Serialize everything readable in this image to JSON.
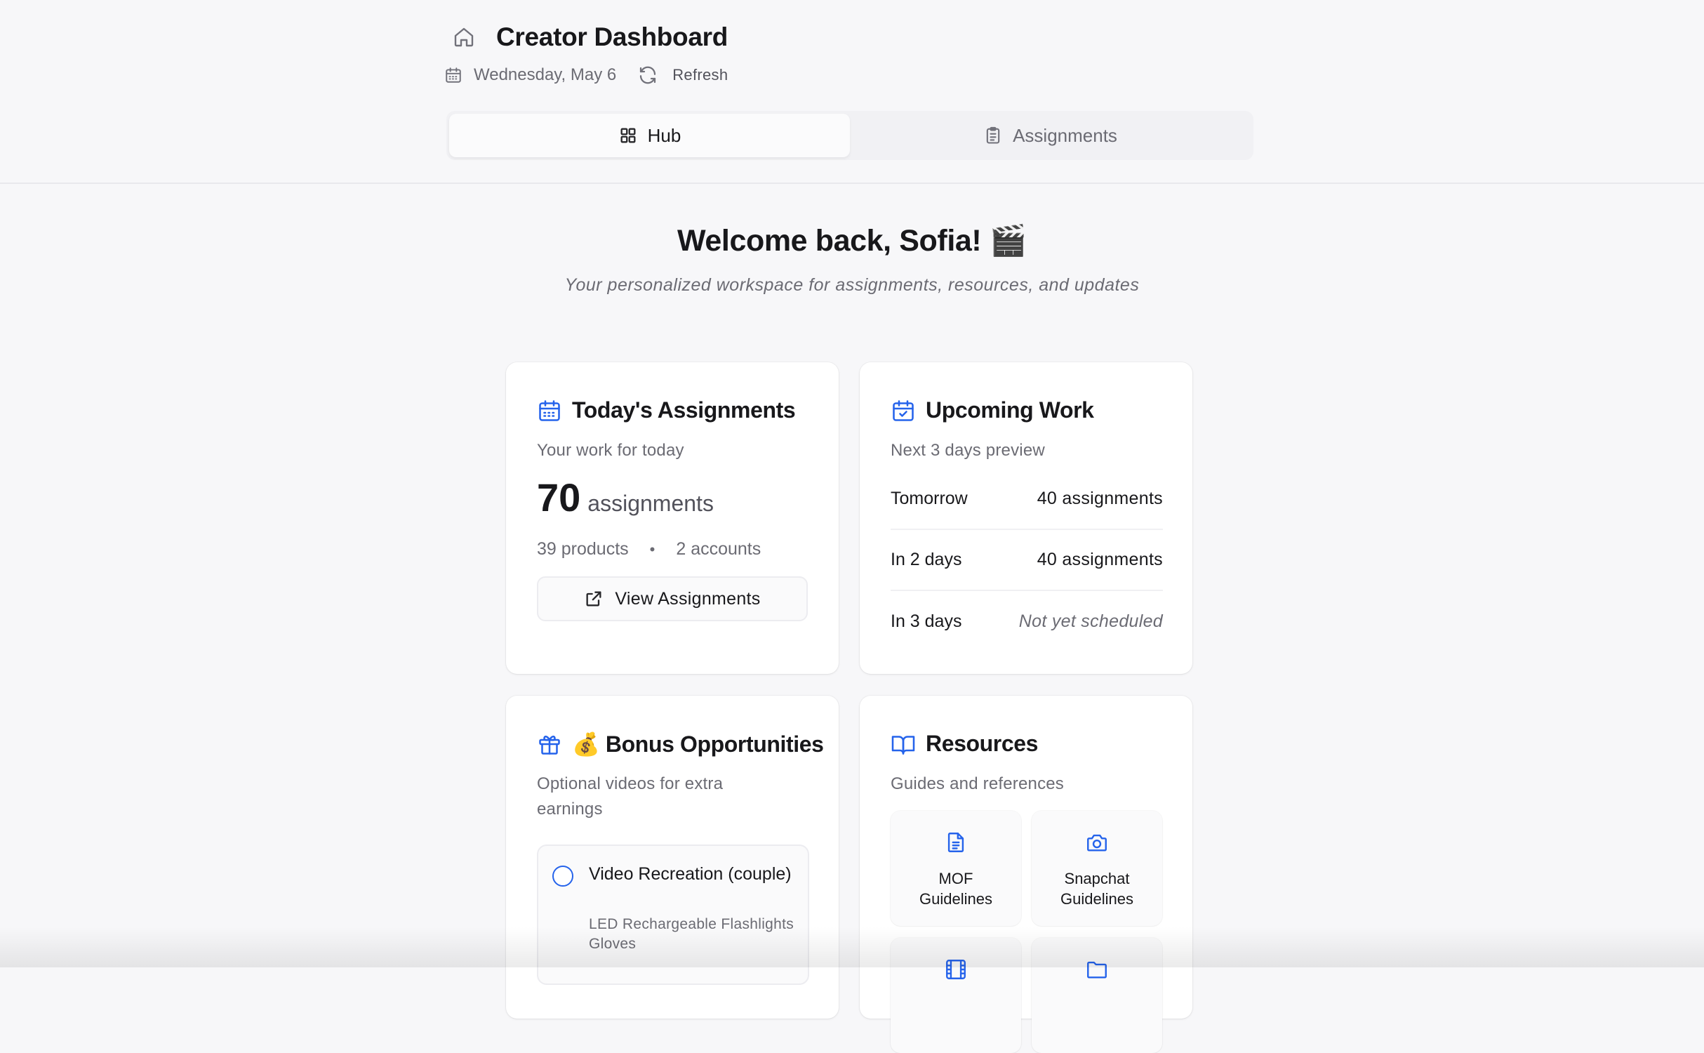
{
  "header": {
    "title": "Creator Dashboard",
    "date": "Wednesday, May 6",
    "refresh_label": "Refresh",
    "icons": {
      "home": "home-icon",
      "calendar": "calendar-icon",
      "refresh": "refresh-icon"
    }
  },
  "tabs": [
    {
      "label": "Hub",
      "icon": "grid-icon",
      "active": true
    },
    {
      "label": "Assignments",
      "icon": "clipboard-icon",
      "active": false
    }
  ],
  "welcome": {
    "title": "Welcome back, Sofia! 🎬",
    "subtitle": "Your personalized workspace for assignments, resources, and updates"
  },
  "today": {
    "title": "Today's Assignments",
    "subtitle": "Your work for today",
    "count": "70",
    "count_unit": "assignments",
    "products": "39 products",
    "separator": "•",
    "accounts": "2 accounts",
    "button_label": "View Assignments"
  },
  "upcoming": {
    "title": "Upcoming Work",
    "subtitle": "Next 3 days preview",
    "rows": [
      {
        "label": "Tomorrow",
        "value": "40 assignments",
        "scheduled": true
      },
      {
        "label": "In 2 days",
        "value": "40 assignments",
        "scheduled": true
      },
      {
        "label": "In 3 days",
        "value": "Not yet scheduled",
        "scheduled": false
      }
    ]
  },
  "bonus": {
    "title": "💰 Bonus Opportunities",
    "subtitle": "Optional videos for extra earnings",
    "items": [
      {
        "title": "Video Recreation (couple)",
        "product": "LED Rechargeable Flashlights Gloves"
      }
    ]
  },
  "resources": {
    "title": "Resources",
    "subtitle": "Guides and references",
    "tiles": [
      {
        "label": "MOF Guidelines",
        "icon": "document-icon"
      },
      {
        "label": "Snapchat Guidelines",
        "icon": "camera-icon"
      }
    ]
  },
  "colors": {
    "accent": "#2563eb",
    "background": "#f7f7f9",
    "card": "#ffffff",
    "muted_text": "#6b6b73"
  }
}
